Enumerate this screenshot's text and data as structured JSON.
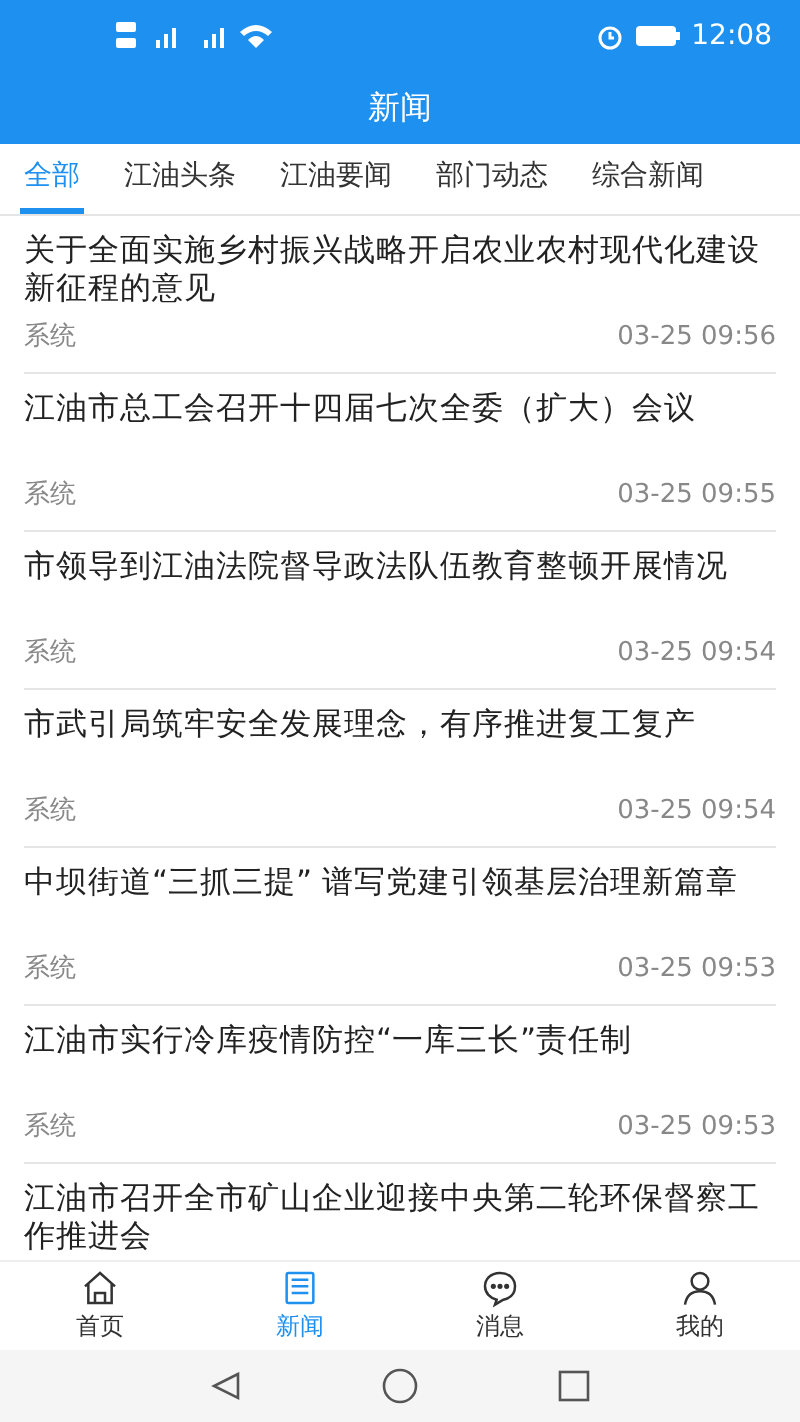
{
  "status_bar": {
    "time": "12:08"
  },
  "header": {
    "title": "新闻"
  },
  "tabs": [
    {
      "label": "全部",
      "selected": true
    },
    {
      "label": "江油头条",
      "selected": false
    },
    {
      "label": "江油要闻",
      "selected": false
    },
    {
      "label": "部门动态",
      "selected": false
    },
    {
      "label": "综合新闻",
      "selected": false
    }
  ],
  "news": [
    {
      "title": "关于全面实施乡村振兴战略开启农业农村现代化建设新征程的意见",
      "source": "系统",
      "time": "03-25 09:56"
    },
    {
      "title": "江油市总工会召开十四届七次全委（扩大）会议",
      "source": "系统",
      "time": "03-25 09:55"
    },
    {
      "title": "市领导到江油法院督导政法队伍教育整顿开展情况",
      "source": "系统",
      "time": "03-25 09:54"
    },
    {
      "title": "市武引局筑牢安全发展理念，有序推进复工复产",
      "source": "系统",
      "time": "03-25 09:54"
    },
    {
      "title": "中坝街道“三抓三提” 谱写党建引领基层治理新篇章",
      "source": "系统",
      "time": "03-25 09:53"
    },
    {
      "title": "江油市实行冷库疫情防控“一库三长”责任制",
      "source": "系统",
      "time": "03-25 09:53"
    },
    {
      "title": "江油市召开全市矿山企业迎接中央第二轮环保督察工作推进会"
    }
  ],
  "bottom_nav": [
    {
      "kind": "home",
      "label": "首页",
      "selected": false
    },
    {
      "kind": "news",
      "label": "新闻",
      "selected": true
    },
    {
      "kind": "message",
      "label": "消息",
      "selected": false
    },
    {
      "kind": "profile",
      "label": "我的",
      "selected": false
    }
  ]
}
